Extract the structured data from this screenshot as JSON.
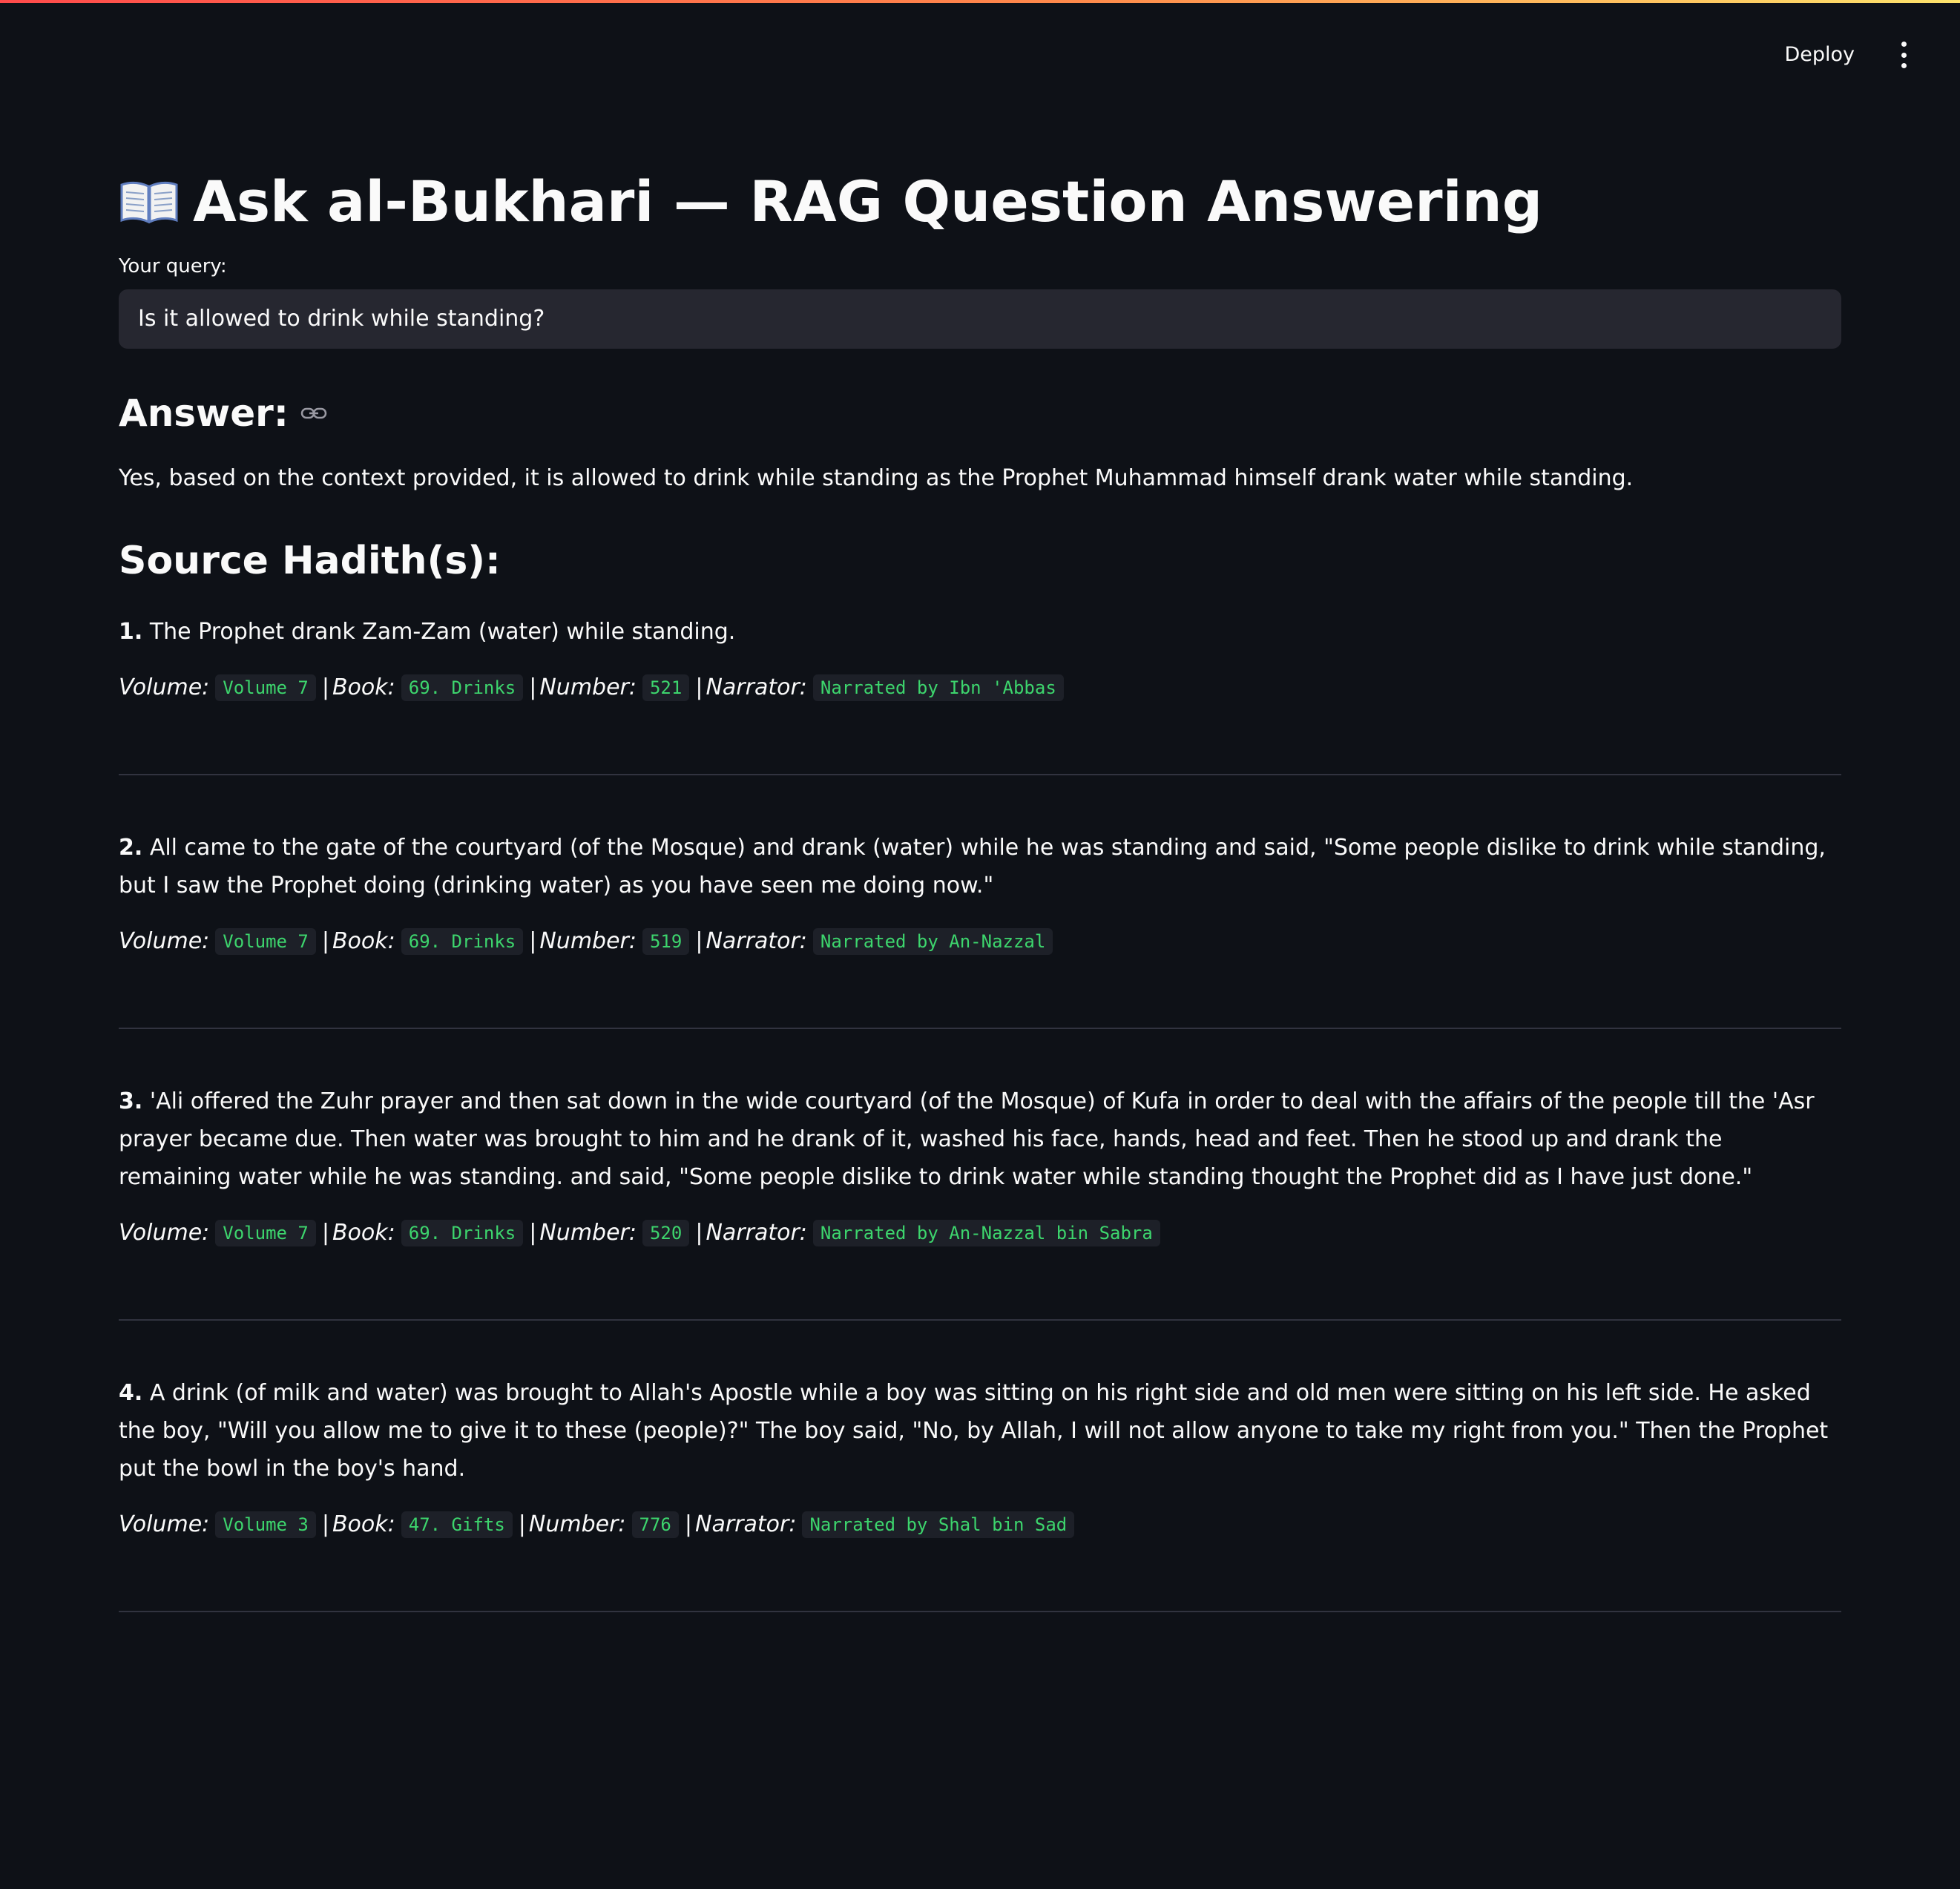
{
  "header": {
    "deploy_label": "Deploy"
  },
  "page": {
    "title": "Ask al-Bukhari — RAG Question Answering",
    "query_label": "Your query:",
    "query_value": "Is it allowed to drink while standing?",
    "answer_heading": "Answer:",
    "answer_text": "Yes, based on the context provided, it is allowed to drink while standing as the Prophet Muhammad himself drank water while standing.",
    "sources_heading": "Source Hadith(s):"
  },
  "labels": {
    "volume": "Volume:",
    "book": "Book:",
    "number": "Number:",
    "narrator": "Narrator:",
    "sep": "|"
  },
  "hadiths": [
    {
      "index": "1.",
      "text": "The Prophet drank Zam-Zam (water) while standing.",
      "volume": "Volume 7",
      "book": "69. Drinks",
      "number": "521",
      "narrator": "Narrated by Ibn 'Abbas"
    },
    {
      "index": "2.",
      "text": "All came to the gate of the courtyard (of the Mosque) and drank (water) while he was standing and said, \"Some people dislike to drink while standing, but I saw the Prophet doing (drinking water) as you have seen me doing now.\"",
      "volume": "Volume 7",
      "book": "69. Drinks",
      "number": "519",
      "narrator": "Narrated by An-Nazzal"
    },
    {
      "index": "3.",
      "text": "'Ali offered the Zuhr prayer and then sat down in the wide courtyard (of the Mosque) of Kufa in order to deal with the affairs of the people till the 'Asr prayer became due. Then water was brought to him and he drank of it, washed his face, hands, head and feet. Then he stood up and drank the remaining water while he was standing. and said, \"Some people dislike to drink water while standing thought the Prophet did as I have just done.\"",
      "volume": "Volume 7",
      "book": "69. Drinks",
      "number": "520",
      "narrator": "Narrated by An-Nazzal bin Sabra"
    },
    {
      "index": "4.",
      "text": "A drink (of milk and water) was brought to Allah's Apostle while a boy was sitting on his right side and old men were sitting on his left side. He asked the boy, \"Will you allow me to give it to these (people)?\" The boy said, \"No, by Allah, I will not allow anyone to take my right from you.\" Then the Prophet put the bowl in the boy's hand.",
      "volume": "Volume 3",
      "book": "47. Gifts",
      "number": "776",
      "narrator": "Narrated by Shal bin Sad"
    }
  ],
  "colors": {
    "background": "#0e1117",
    "input_bg": "#262730",
    "pill_text": "#3dd56d",
    "pill_bg": "#1d2028",
    "divider": "#31333f"
  },
  "icons": [
    "open-book-icon",
    "link-icon",
    "more-vert-icon"
  ]
}
